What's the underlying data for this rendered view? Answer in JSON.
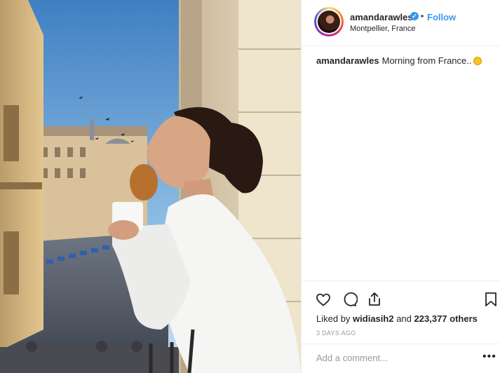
{
  "post": {
    "username": "amandarawles",
    "verified": true,
    "separator": "•",
    "follow_label": "Follow",
    "location": "Montpellier, France",
    "caption_user": "amandarawles",
    "caption_text": "Morning from France..",
    "caption_emoji": "sun-emoji",
    "likes_prefix": "Liked by",
    "likes_user": "widiasih2",
    "likes_mid": "and",
    "likes_count": "223,377 others",
    "timestamp": "3 DAYS AGO",
    "comment_placeholder": "Add a comment...",
    "more_label": "•••"
  },
  "icons": {
    "like": "heart-icon",
    "comment": "comment-icon",
    "share": "share-icon",
    "save": "bookmark-icon",
    "verified": "verified-badge-icon"
  },
  "colors": {
    "accent": "#3897f0",
    "text": "#262626",
    "muted": "#999999",
    "divider": "#efefef"
  }
}
